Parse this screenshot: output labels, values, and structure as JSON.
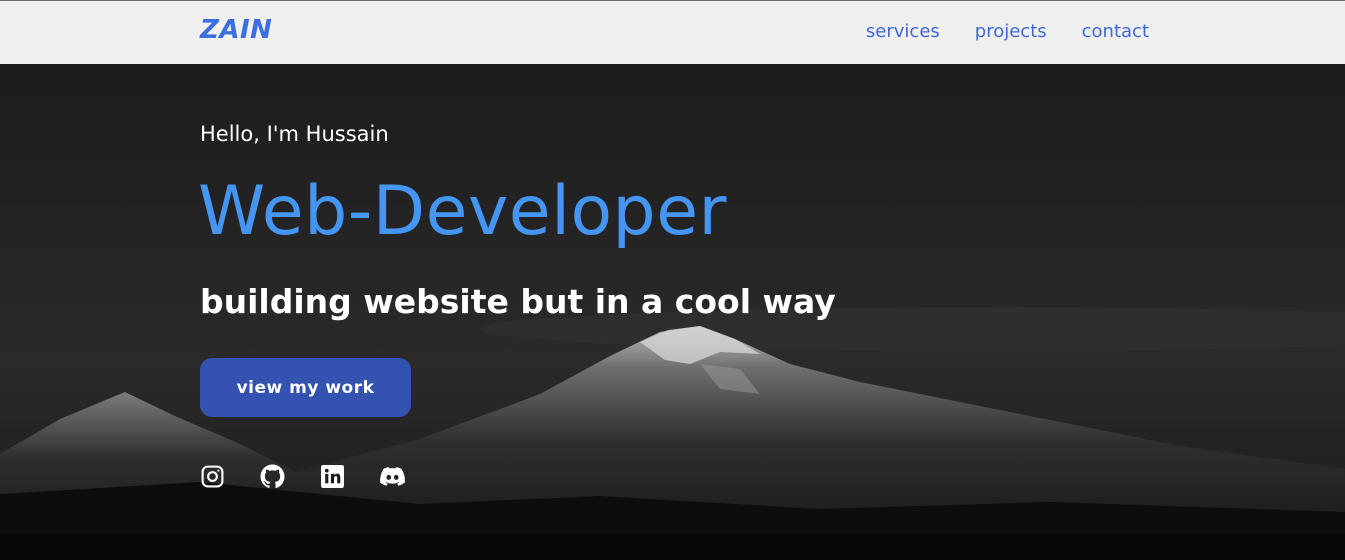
{
  "navbar": {
    "logo": "ZAIN",
    "links": [
      {
        "label": "services"
      },
      {
        "label": "projects"
      },
      {
        "label": "contact"
      }
    ]
  },
  "hero": {
    "greeting": "Hello, I'm Hussain",
    "headline": "Web-Developer",
    "tagline": "building website but in a cool way",
    "cta_label": "view my work",
    "socials": [
      "instagram-icon",
      "github-icon",
      "linkedin-icon",
      "discord-icon"
    ]
  },
  "colors": {
    "accent": "#4596f2",
    "nav_text": "#3f68d6",
    "button": "#3453b0",
    "navbar_bg": "#f0f0f0"
  }
}
